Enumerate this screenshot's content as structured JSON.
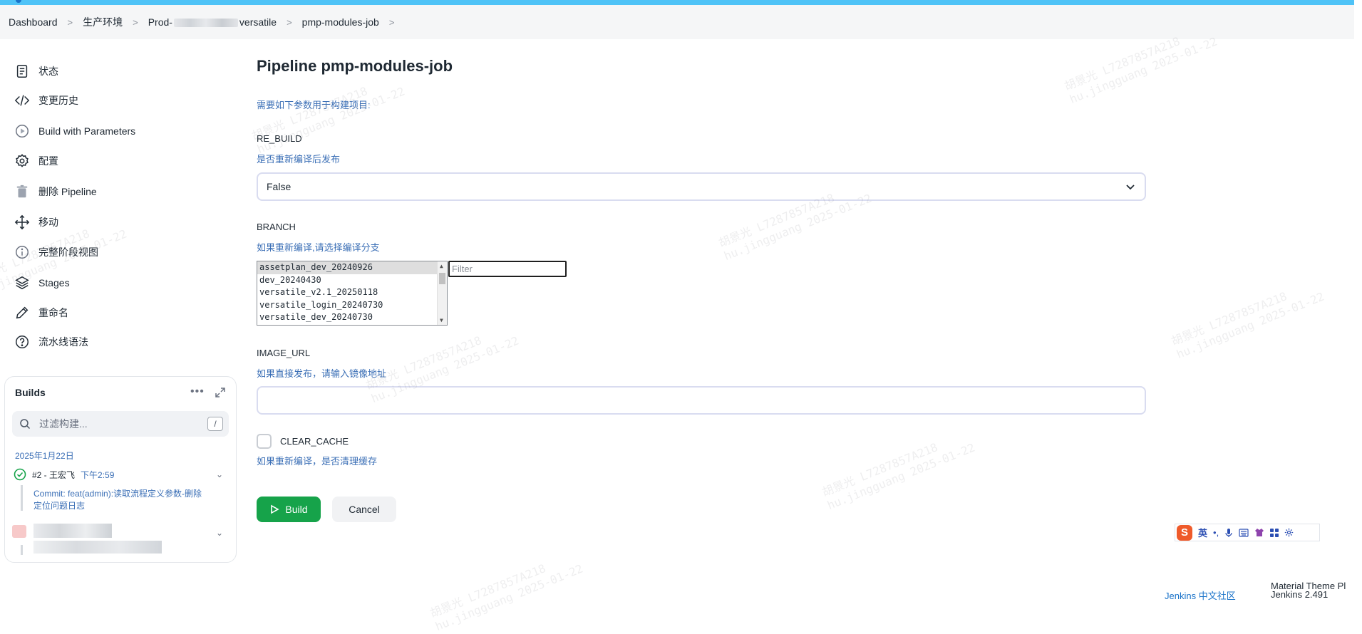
{
  "breadcrumb": {
    "items": [
      "Dashboard",
      "生产环境",
      "Prod-",
      "versatile",
      "pmp-modules-job"
    ]
  },
  "sidebar": {
    "items": [
      {
        "label": "状态",
        "icon": "document-icon"
      },
      {
        "label": "变更历史",
        "icon": "code-icon"
      },
      {
        "label": "Build with Parameters",
        "icon": "play-circle-icon"
      },
      {
        "label": "配置",
        "icon": "gear-icon"
      },
      {
        "label": "删除 Pipeline",
        "icon": "trash-icon"
      },
      {
        "label": "移动",
        "icon": "move-icon"
      },
      {
        "label": "完整阶段视图",
        "icon": "info-icon"
      },
      {
        "label": "Stages",
        "icon": "layers-icon"
      },
      {
        "label": "重命名",
        "icon": "pencil-icon"
      },
      {
        "label": "流水线语法",
        "icon": "help-icon"
      }
    ]
  },
  "builds": {
    "title": "Builds",
    "more": "•••",
    "filter_placeholder": "过滤构建...",
    "shortcut": "/",
    "date": "2025年1月22日",
    "entries": [
      {
        "name": "#2 - 王宏飞",
        "time": "下午2:59",
        "commit": "Commit: feat(admin):读取流程定义参数-删除定位问题日志"
      }
    ]
  },
  "main": {
    "title": "Pipeline pmp-modules-job",
    "description": "需要如下参数用于构建项目:",
    "params": {
      "re_build": {
        "name": "RE_BUILD",
        "desc": "是否重新编译后发布",
        "selected": "False"
      },
      "branch": {
        "name": "BRANCH",
        "desc": "如果重新编译,请选择编译分支",
        "options": [
          "assetplan_dev_20240926",
          "dev_20240430",
          "versatile_v2.1_20250118",
          "versatile_login_20240730",
          "versatile_dev_20240730"
        ],
        "selected_index": 0,
        "filter_placeholder": "Filter"
      },
      "image_url": {
        "name": "IMAGE_URL",
        "desc": "如果直接发布，请输入镜像地址",
        "value": ""
      },
      "clear_cache": {
        "name": "CLEAR_CACHE",
        "desc": "如果重新编译，是否清理缓存",
        "checked": false
      }
    },
    "build_button": "Build",
    "cancel_button": "Cancel"
  },
  "ime": {
    "logo": "S",
    "mode": "英",
    "items": [
      "•,",
      "mic-icon",
      "keyboard-icon",
      "shirt-icon",
      "grid-icon",
      "settings-icon"
    ]
  },
  "footer": {
    "community_link": "Jenkins 中文社区",
    "theme": "Material Theme Pl",
    "version": "Jenkins 2.491"
  },
  "watermark": {
    "line1": "胡景光 L7287857A218",
    "line2": "hu.jingguang 2025-01-22"
  },
  "colors": {
    "accent": "#4fc3f7",
    "link": "#3b6fb6",
    "build_green": "#16a34a",
    "success": "#16a34a"
  }
}
